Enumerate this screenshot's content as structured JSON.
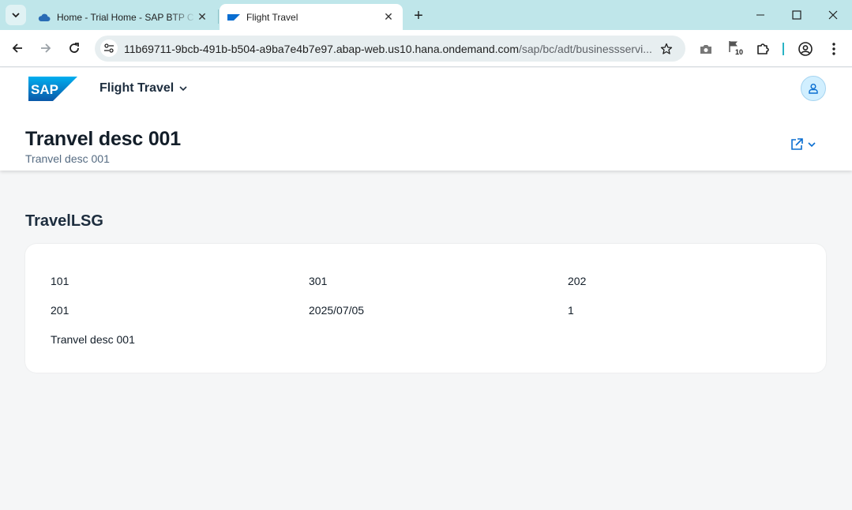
{
  "browser": {
    "tabs": [
      {
        "title": "Home - Trial Home - SAP BTP C",
        "active": false,
        "favicon": "cloud-icon"
      },
      {
        "title": "Flight Travel",
        "active": true,
        "favicon": "sap-favicon"
      }
    ],
    "url_host": "11b69711-9bcb-491b-b504-a9ba7e4b7e97.abap-web.us10.hana.ondemand.com",
    "url_path": "/sap/bc/adt/businessservi...",
    "extension_badge": "10"
  },
  "shell": {
    "app_title": "Flight Travel",
    "logo_text": "SAP"
  },
  "header": {
    "title": "Tranvel desc 001",
    "subtitle": "Tranvel desc 001"
  },
  "section": {
    "title": "TravelLSG",
    "rows": [
      [
        "101",
        "301",
        "202"
      ],
      [
        "201",
        "2025/07/05",
        "1"
      ],
      [
        "Tranvel desc 001",
        "",
        ""
      ]
    ]
  },
  "colors": {
    "tabstrip": "#bfe6ea",
    "sap_blue": "#0a6ed1",
    "title_text": "#131e29",
    "page_bg": "#f5f6f7"
  }
}
